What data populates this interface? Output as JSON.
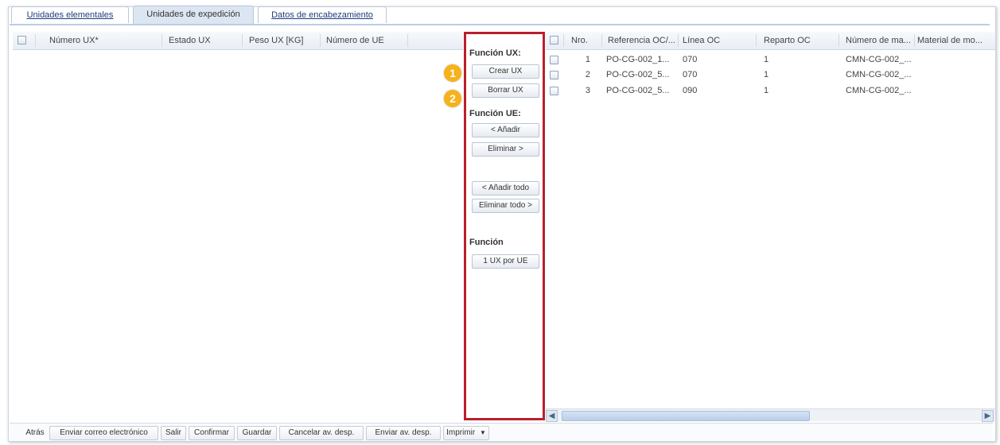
{
  "tabs": [
    {
      "label": "Unidades elementales"
    },
    {
      "label": "Unidades de expedición"
    },
    {
      "label": "Datos de encabezamiento"
    }
  ],
  "left_grid": {
    "columns": [
      "Número UX*",
      "Estado UX",
      "Peso UX [KG]",
      "Número de UE"
    ]
  },
  "middle": {
    "ux_title": "Función UX:",
    "ux_buttons": [
      "Crear UX",
      "Borrar UX"
    ],
    "ue_title": "Función UE:",
    "ue_buttons": [
      "< Añadir",
      "Eliminar >"
    ],
    "all_buttons": [
      "< Añadir todo",
      "Eliminar todo >"
    ],
    "fn_title": "Función",
    "fn_buttons": [
      "1 UX por UE"
    ]
  },
  "markers": [
    "1",
    "2"
  ],
  "right_grid": {
    "columns": [
      "Nro.",
      "Referencia OC/...",
      "Línea OC",
      "Reparto OC",
      "Número de ma...",
      "Material de mo..."
    ],
    "rows": [
      {
        "nro": "1",
        "ref": "PO-CG-002_1...",
        "linea": "070",
        "reparto": "1",
        "material": "CMN-CG-002_..."
      },
      {
        "nro": "2",
        "ref": "PO-CG-002_5...",
        "linea": "070",
        "reparto": "1",
        "material": "CMN-CG-002_..."
      },
      {
        "nro": "3",
        "ref": "PO-CG-002_5...",
        "linea": "090",
        "reparto": "1",
        "material": "CMN-CG-002_..."
      }
    ]
  },
  "toolbar": {
    "buttons": [
      "Atrás",
      "Enviar correo electrónico",
      "Salir",
      "Confirmar",
      "Guardar",
      "Cancelar av. desp.",
      "Enviar av. desp.",
      "Imprimir"
    ],
    "dropdown_icon": "caret-down-icon"
  },
  "colors": {
    "highlight": "#b8202b",
    "marker": "#f6b21b",
    "link": "#1f3d7a"
  }
}
